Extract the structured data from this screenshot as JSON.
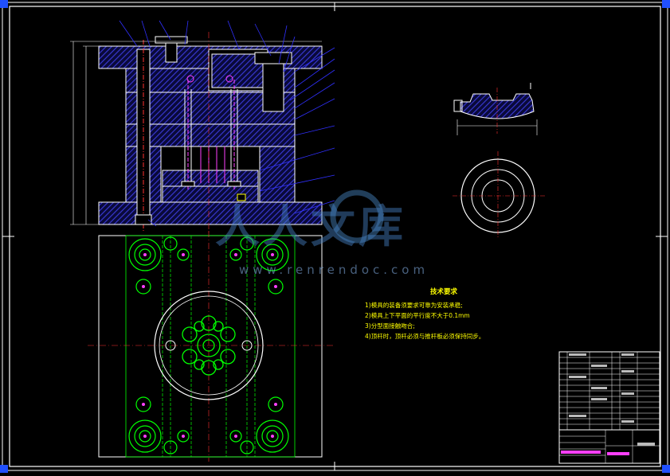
{
  "watermark": {
    "brand": "人人文库",
    "url": "www.renrendoc.com"
  },
  "technical_requirements": {
    "title": "技术要求",
    "items": [
      "1)模具的装备须要求可靠为安装承稳;",
      "2)模具上下平面的平行度不大于0.1mm",
      "3)分型面接触吻合;",
      "4)顶杆时，顶杆必须与推杆板必须保持同步。"
    ]
  },
  "colors": {
    "background": "#000000",
    "outline": "#ffffff",
    "section_hatch": "#3a3ad8",
    "centerline": "#ff3030",
    "leader": "#3030ff",
    "component": "#00ff00",
    "ejector": "#ff40ff",
    "notes": "#ffff00",
    "title_block_marks": "#ff40ff"
  }
}
